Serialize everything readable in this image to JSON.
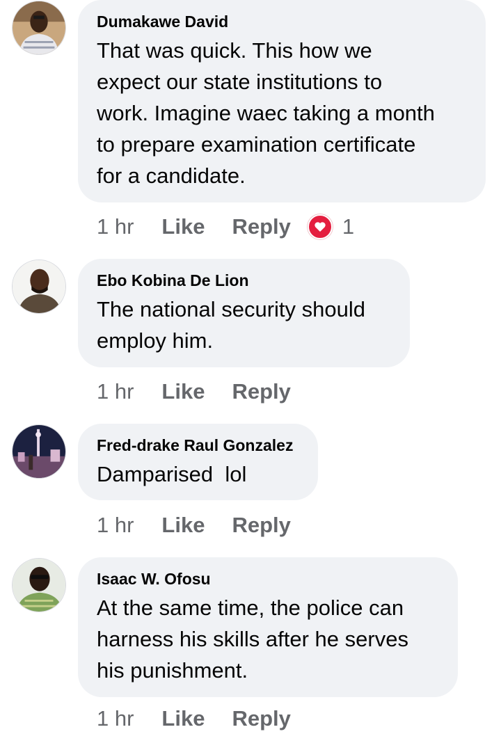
{
  "comments": [
    {
      "author": "Dumakawe David",
      "text": "That was quick. This how we\nexpect our state institutions to\nwork. Imagine waec taking a month\nto prepare examination certificate\nfor a candidate.",
      "time": "1 hr",
      "like_label": "Like",
      "reply_label": "Reply",
      "reaction": {
        "icon": "heart-icon",
        "count": "1"
      }
    },
    {
      "author": "Ebo Kobina De Lion",
      "text": "The national security should\nemploy him.",
      "time": "1 hr",
      "like_label": "Like",
      "reply_label": "Reply"
    },
    {
      "author": "Fred-drake Raul Gonzalez",
      "text": "Damparised  lol",
      "time": "1 hr",
      "like_label": "Like",
      "reply_label": "Reply"
    },
    {
      "author": "Isaac W. Ofosu",
      "text": "At the same time, the police can\nharness his skills after he serves\nhis punishment.",
      "time": "1 hr",
      "like_label": "Like",
      "reply_label": "Reply"
    }
  ],
  "colors": {
    "bubble": "#f0f2f5",
    "meta_text": "#65676b",
    "love_reaction": "#e41e3f"
  }
}
